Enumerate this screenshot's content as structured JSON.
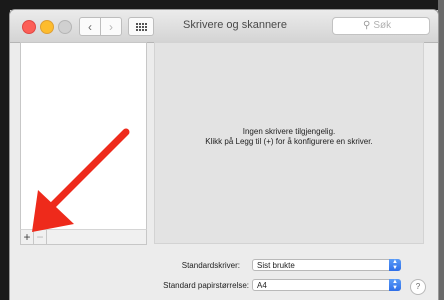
{
  "window": {
    "title": "Skrivere og skannere",
    "search_placeholder": "Søk",
    "nav_back": "‹",
    "nav_forward": "›"
  },
  "printer_list": {
    "add_label": "+",
    "remove_label": "−"
  },
  "detail": {
    "empty_line1": "Ingen skrivere tilgjengelig.",
    "empty_line2": "Klikk på Legg til (+) for å konfigurere en skriver."
  },
  "settings": {
    "default_printer_label": "Standardskriver:",
    "default_printer_value": "Sist brukte",
    "default_paper_label": "Standard papirstørrelse:",
    "default_paper_value": "A4"
  },
  "help_label": "?",
  "colors": {
    "close": "#fc5f57",
    "minimize": "#fdbc2e",
    "arrow": "#ee2a1b",
    "popup_accent": "#2e6ee8"
  },
  "icons": {
    "back": "chevron-left-icon",
    "forward": "chevron-right-icon",
    "show_all": "grid-icon",
    "search": "magnifier-icon",
    "annotation": "red-arrow-icon"
  }
}
